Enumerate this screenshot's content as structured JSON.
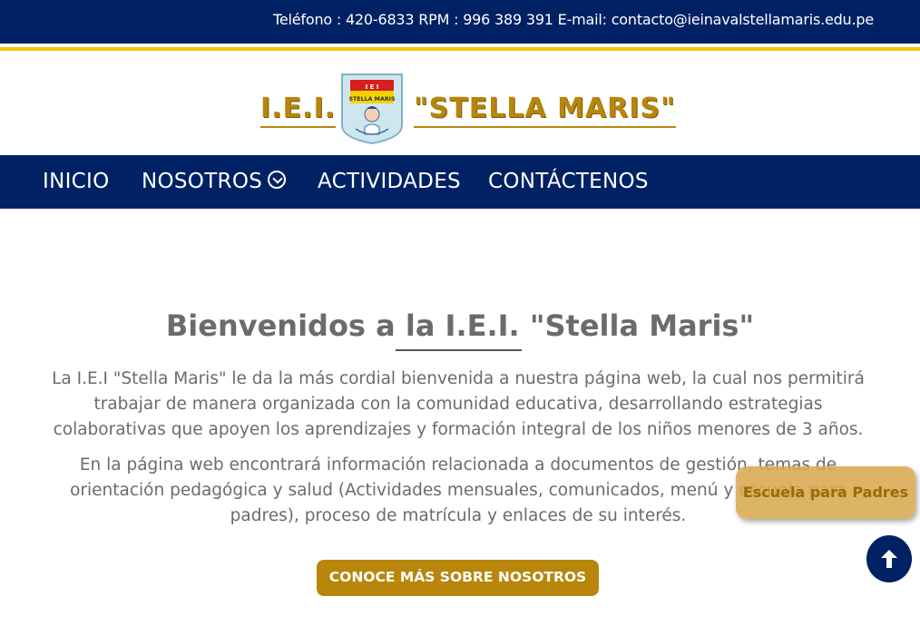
{
  "topbar": {
    "contact_line": "Teléfono : 420-6833 RPM : 996 389 391 E-mail: contacto@ieinavalstellamaris.edu.pe"
  },
  "brand": {
    "left_text": "I.E.I.",
    "right_text": "\"STELLA MARIS\"",
    "crest_top_text": "I E I",
    "crest_name_text": "STELLA MARIS"
  },
  "nav": {
    "items": [
      {
        "label": "INICIO"
      },
      {
        "label": "NOSOTROS"
      },
      {
        "label": "ACTIVIDADES"
      },
      {
        "label": "CONTÁCTENOS"
      }
    ]
  },
  "main": {
    "title": "Bienvenidos a la I.E.I. \"Stella Maris\"",
    "paragraph_1": "La I.E.I \"Stella Maris\" le da la más cordial bienvenida a nuestra página web, la cual nos permitirá trabajar de manera organizada con la comunidad educativa, desarrollando estrategias colaborativas que apoyen los aprendizajes y formación integral de los niños menores de 3 años.",
    "paragraph_2": "En la página web encontrará información relacionada a documentos de gestión, temas de orientación pedagógica y salud (Actividades mensuales, comunicados, menú y escuela para padres), proceso de matrícula y enlaces de su interés.",
    "cta_label": "CONOCE MÁS SOBRE NOSOTROS >"
  },
  "floating": {
    "label": "Escuela para Padres"
  },
  "colors": {
    "navy": "#002164",
    "gold": "#b8860b",
    "yellow_line": "#f5c400"
  },
  "icons": {
    "dropdown": "chevron-down-circle-icon",
    "back_to_top": "arrow-up-icon"
  }
}
